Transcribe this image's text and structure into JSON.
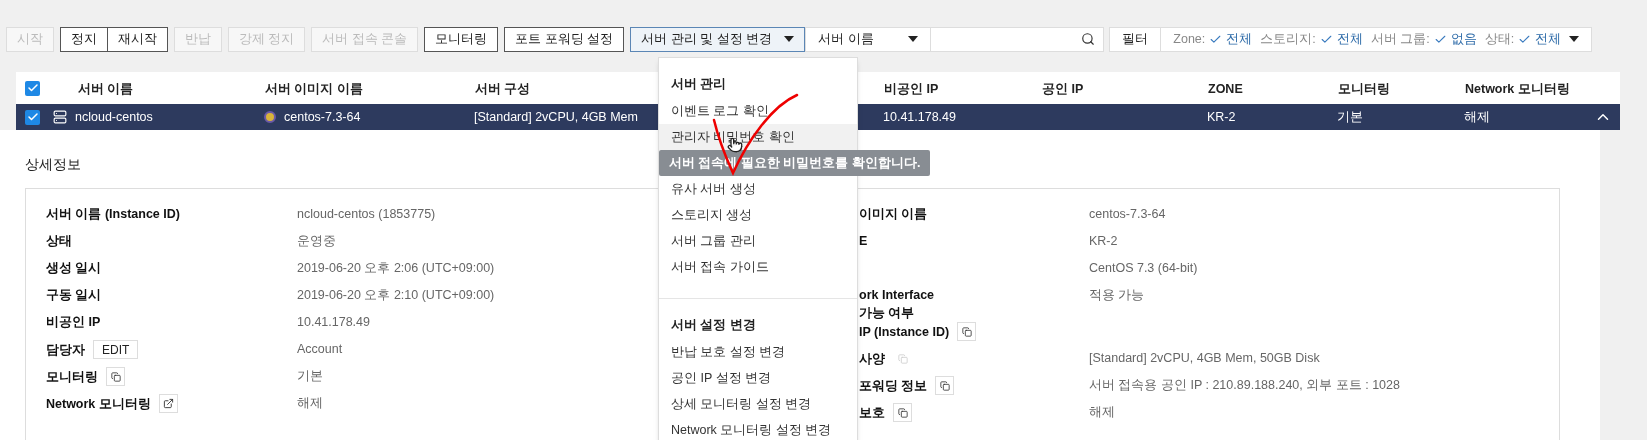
{
  "toolbar": {
    "button_groups": [
      [
        {
          "kind": "button",
          "label": "시작",
          "disabled": true
        }
      ],
      [
        {
          "kind": "button",
          "label": "정지",
          "disabled": false
        },
        {
          "kind": "button",
          "label": "재시작",
          "disabled": false
        }
      ],
      [
        {
          "kind": "button",
          "label": "반납",
          "disabled": true
        }
      ],
      [
        {
          "kind": "button",
          "label": "강제 정지",
          "disabled": true
        }
      ],
      [
        {
          "kind": "button",
          "label": "서버 접속 콘솔",
          "disabled": true
        }
      ],
      [
        {
          "kind": "button",
          "label": "모니터링",
          "disabled": false
        }
      ],
      [
        {
          "kind": "button",
          "label": "포트 포워딩 설정",
          "disabled": false
        }
      ],
      [
        {
          "kind": "dropdown",
          "label": "서버 관리 및 설정 변경",
          "disabled": false,
          "expanded": true
        }
      ]
    ],
    "search": {
      "field": "서버 이름"
    },
    "filter_button": "필터",
    "filters": [
      {
        "label": "Zone:",
        "value": "전체"
      },
      {
        "label": "스토리지:",
        "value": "전체"
      },
      {
        "label": "서버 그룹:",
        "value": "없음"
      },
      {
        "label": "상태:",
        "value": "전체"
      }
    ]
  },
  "table": {
    "all_checked": true,
    "columns": [
      "서버 이름",
      "서버 이미지 이름",
      "서버 구성",
      "비공인 IP",
      "공인 IP",
      "ZONE",
      "모니터링",
      "Network 모니터링"
    ],
    "rows": [
      {
        "checked": true,
        "selected": true,
        "expanded": true,
        "cells": [
          "ncloud-centos",
          "centos-7.3-64",
          "[Standard] 2vCPU, 4GB Mem",
          "10.41.178.49",
          "",
          "KR-2",
          "기본",
          "해제"
        ]
      }
    ]
  },
  "details": {
    "title": "상세정보",
    "left": [
      {
        "kind": "plain",
        "label": "서버 이름 (Instance ID)",
        "value": "ncloud-centos (1853775)"
      },
      {
        "kind": "plain",
        "label": "상태",
        "value": "운영중"
      },
      {
        "kind": "plain",
        "label": "생성 일시",
        "value": "2019-06-20 오후 2:06 (UTC+09:00)"
      },
      {
        "kind": "plain",
        "label": "구동 일시",
        "value": "2019-06-20 오후 2:10 (UTC+09:00)"
      },
      {
        "kind": "plain",
        "label": "비공인 IP",
        "value": "10.41.178.49"
      },
      {
        "kind": "edit",
        "label": "담당자",
        "button": "EDIT",
        "value": "Account"
      },
      {
        "kind": "copy",
        "label": "모니터링",
        "value": "기본"
      },
      {
        "kind": "external",
        "label": "Network 모니터링",
        "value": "해제"
      }
    ],
    "right": [
      {
        "kind": "plain",
        "label": "이미지 이름",
        "value": "centos-7.3-64"
      },
      {
        "kind": "plain",
        "label": "E",
        "value": "KR-2"
      },
      {
        "kind": "plain",
        "value": "CentOS 7.3 (64-bit)"
      },
      {
        "kind": "plain",
        "label": "ork Interface\n가능 여부",
        "value": "적용 가능"
      },
      {
        "kind": "copy",
        "label": "IP (Instance ID)"
      },
      {
        "kind": "copy-faint",
        "label": "사양",
        "value": "[Standard] 2vCPU, 4GB Mem, 50GB Disk"
      },
      {
        "kind": "copy",
        "label": "포워딩 정보",
        "value": "서버 접속용 공인 IP : 210.89.188.240, 외부 포트 : 1028"
      },
      {
        "kind": "copy",
        "label": "보호",
        "value": "해제"
      }
    ]
  },
  "menu": {
    "sections": [
      {
        "title": "서버 관리",
        "items": [
          {
            "label": "이벤트 로그 확인",
            "hovered": false
          },
          {
            "label": "관리자 비밀번호 확인",
            "hovered": true,
            "tooltip": "서버 접속에 필요한 비밀번호를 확인합니다."
          },
          {
            "label": "유사 서버 생성",
            "hovered": false
          },
          {
            "label": "스토리지 생성",
            "hovered": false
          },
          {
            "label": "서버 그룹 관리",
            "hovered": false
          },
          {
            "label": "서버 접속 가이드",
            "hovered": false
          }
        ]
      },
      {
        "title": "서버 설정 변경",
        "items": [
          {
            "label": "반납 보호 설정 변경",
            "hovered": false
          },
          {
            "label": "공인 IP 설정 변경",
            "hovered": false
          },
          {
            "label": "상세 모니터링 설정 변경",
            "hovered": false
          },
          {
            "label": "Network 모니터링 설정 변경",
            "hovered": false
          }
        ]
      }
    ]
  }
}
